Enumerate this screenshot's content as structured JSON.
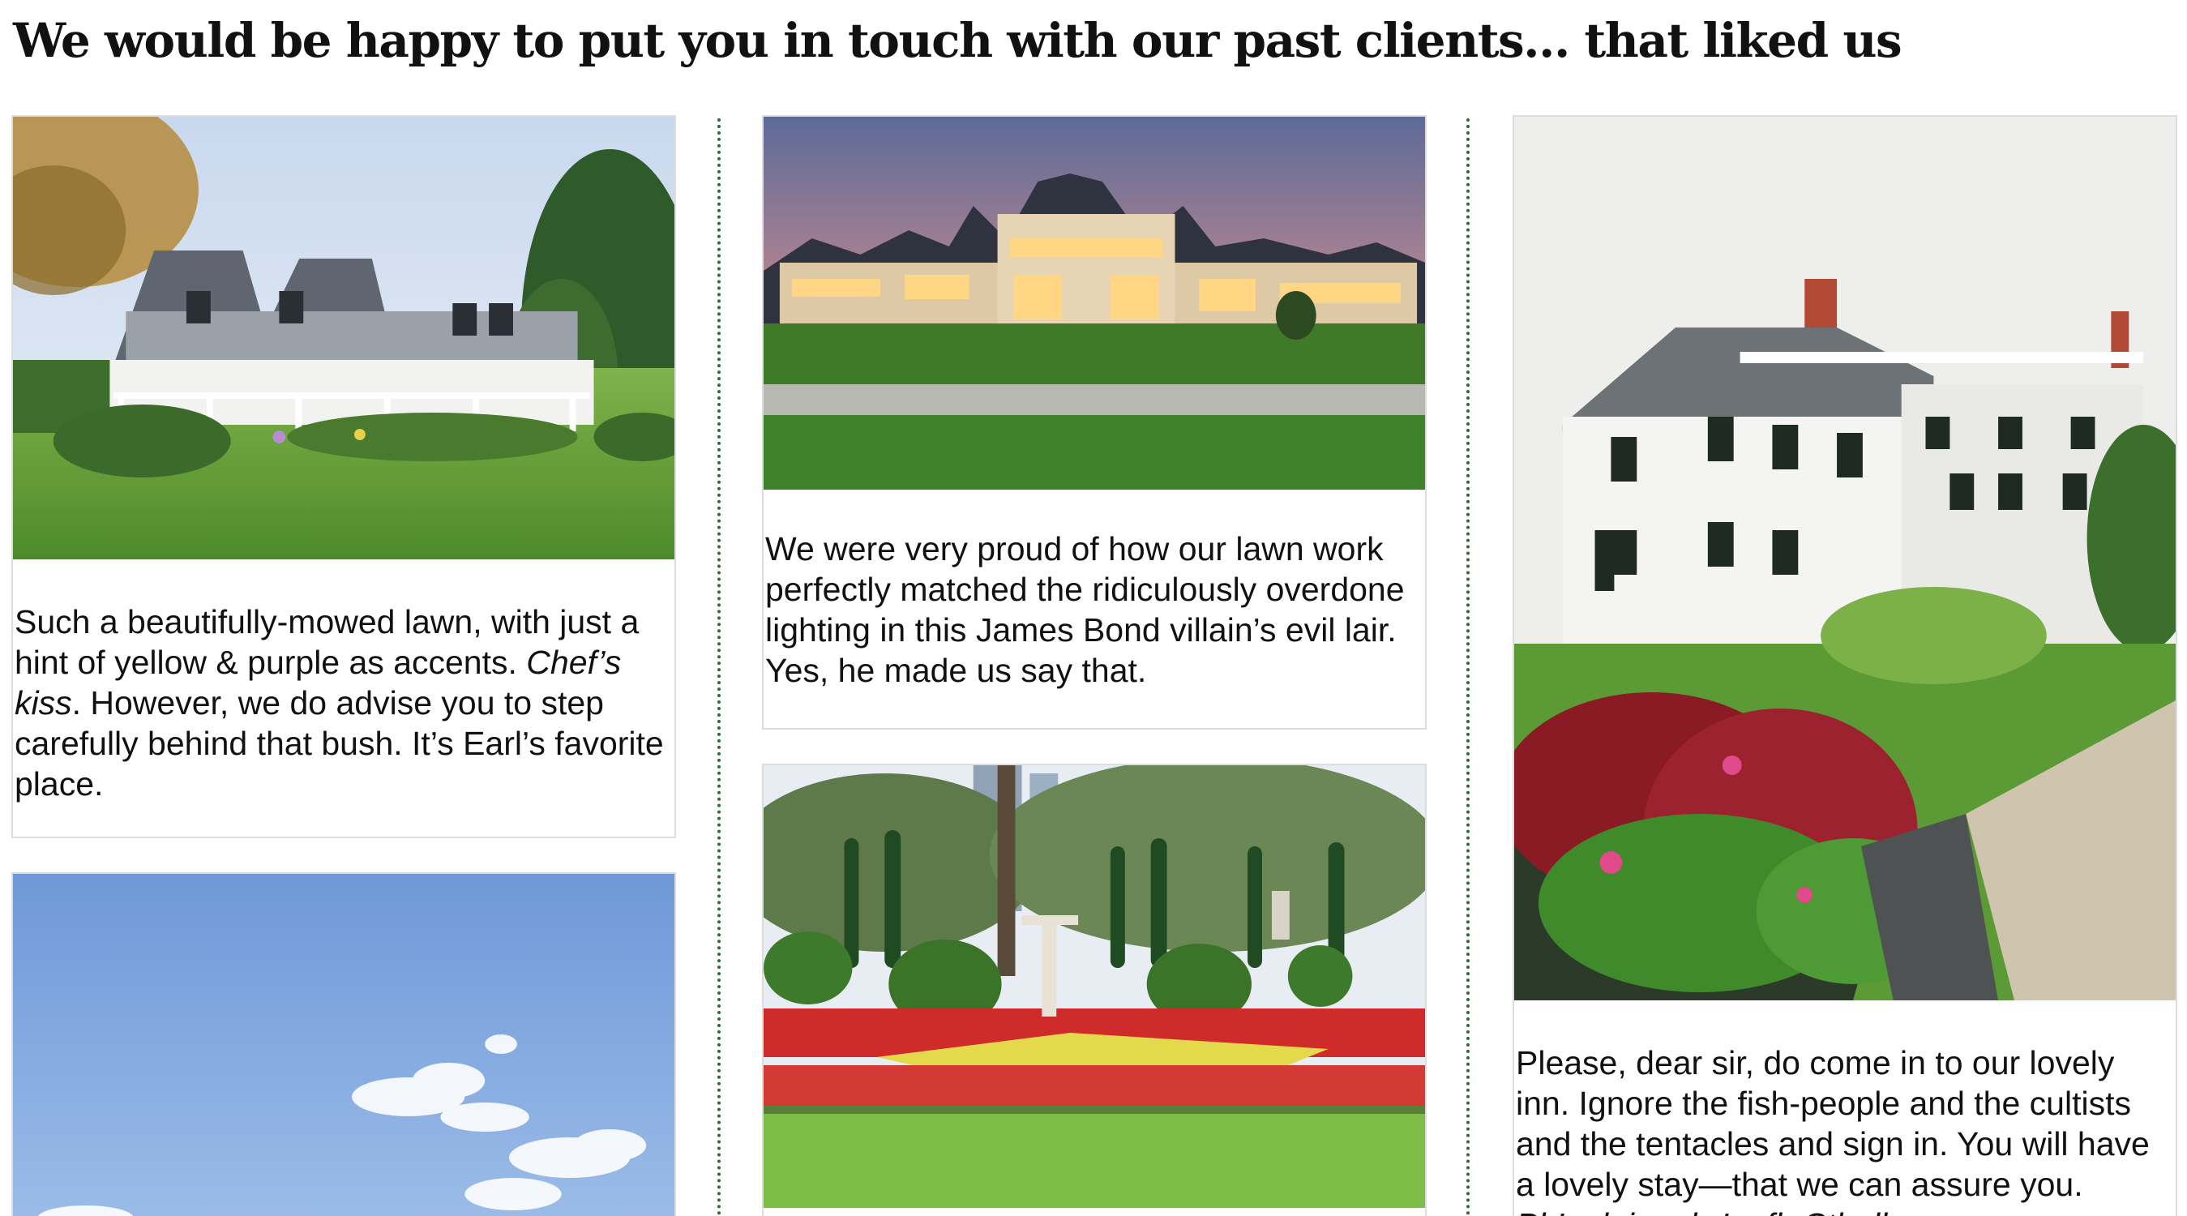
{
  "headline": "We would be happy to put you in touch with our past clients… that liked us",
  "colors": {
    "divider": "#2e6b37",
    "card_border": "#dcdcdc",
    "text": "#111111"
  },
  "cards": [
    {
      "image": "cape-cod-house-photo",
      "caption_lead": "Such a beautifully-mowed lawn, with just a hint of yellow & purple as accents. ",
      "caption_em": "Chef’s kiss",
      "caption_tail": ". However, we do advise you to step carefully behind that bush. It’s Earl’s favorite place."
    },
    {
      "image": "blue-sky-photo"
    },
    {
      "image": "lit-mansion-dusk-photo",
      "caption": "We were very proud of how our lawn work perfectly matched the ridiculously overdone lighting in this James Bond villain’s evil lair. Yes, he made us say that."
    },
    {
      "image": "formal-flower-garden-photo"
    },
    {
      "image": "white-colonial-inn-photo",
      "caption_lead": "Please, dear sir, do come in to our lovely inn. Ignore the fish-people and the cultists and the tentacles and sign in. You will have a lovely stay—that we can assure you. ",
      "caption_em": "Ph’nglui mglw’nafh Cthulhu"
    }
  ]
}
